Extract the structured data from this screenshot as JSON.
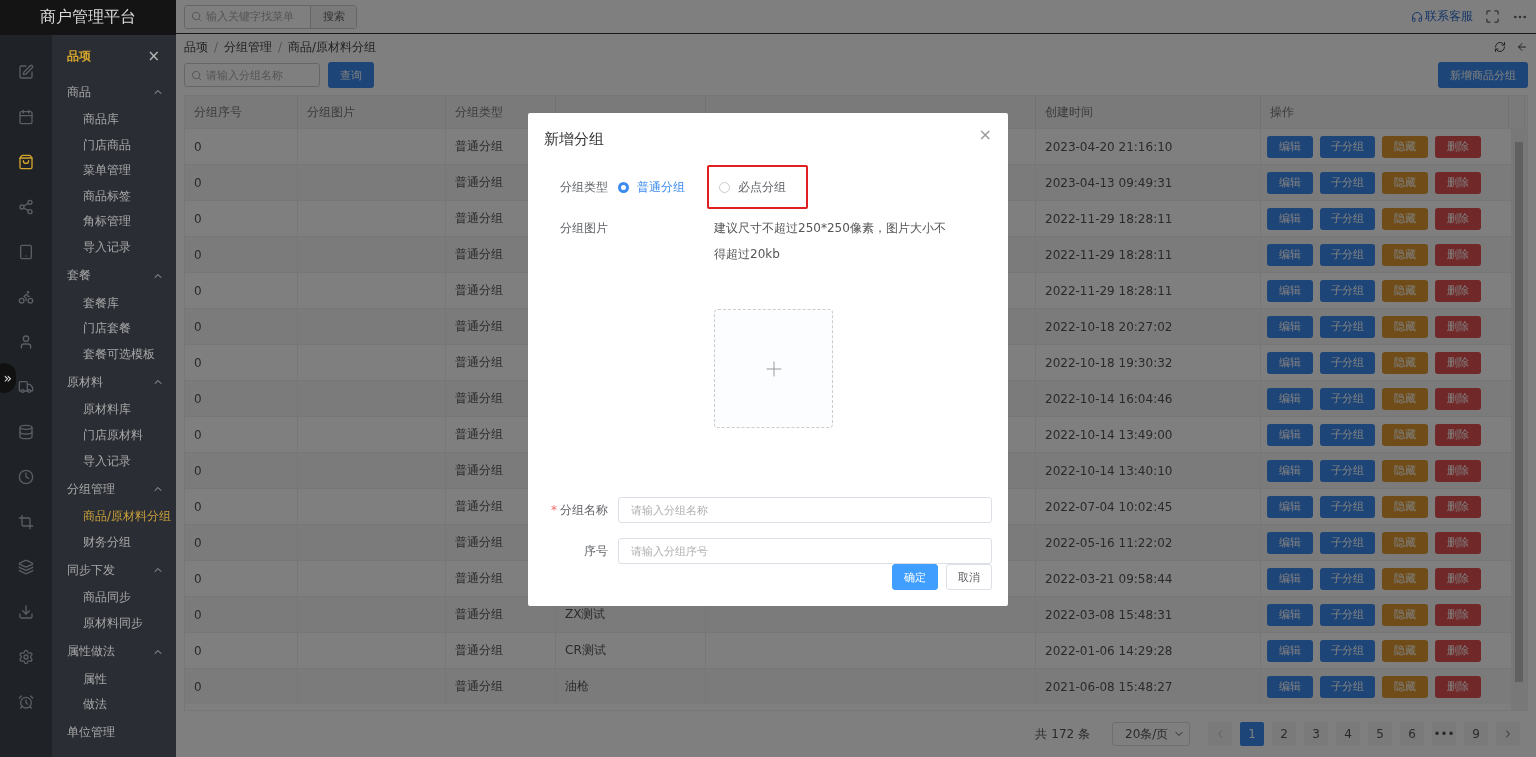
{
  "sidebar": {
    "logo": "商户管理平台",
    "rail": [
      {
        "selected": false
      },
      {
        "selected": false
      },
      {
        "selected": true
      },
      {
        "selected": false
      },
      {
        "selected": false
      },
      {
        "selected": false
      },
      {
        "selected": false
      },
      {
        "selected": false
      },
      {
        "selected": false
      },
      {
        "selected": false
      },
      {
        "selected": false
      },
      {
        "selected": false
      },
      {
        "selected": false
      },
      {
        "selected": false
      },
      {
        "selected": false
      }
    ],
    "collapse_toggle": "»",
    "menu_title": "品项",
    "menu_close": "×",
    "menu": [
      {
        "kind": "group",
        "label": "商品",
        "expanded": true,
        "children": [
          {
            "label": "商品库",
            "selected": false
          },
          {
            "label": "门店商品",
            "selected": false
          },
          {
            "label": "菜单管理",
            "selected": false
          },
          {
            "label": "商品标签",
            "selected": false
          },
          {
            "label": "角标管理",
            "selected": false
          },
          {
            "label": "导入记录",
            "selected": false
          }
        ]
      },
      {
        "kind": "group",
        "label": "套餐",
        "expanded": true,
        "children": [
          {
            "label": "套餐库",
            "selected": false
          },
          {
            "label": "门店套餐",
            "selected": false
          },
          {
            "label": "套餐可选模板",
            "selected": false
          }
        ]
      },
      {
        "kind": "group",
        "label": "原材料",
        "expanded": true,
        "children": [
          {
            "label": "原材料库",
            "selected": false
          },
          {
            "label": "门店原材料",
            "selected": false
          },
          {
            "label": "导入记录",
            "selected": false
          }
        ]
      },
      {
        "kind": "group",
        "label": "分组管理",
        "expanded": true,
        "children": [
          {
            "label": "商品/原材料分组",
            "selected": true
          },
          {
            "label": "财务分组",
            "selected": false
          }
        ]
      },
      {
        "kind": "group",
        "label": "同步下发",
        "expanded": true,
        "children": [
          {
            "label": "商品同步",
            "selected": false
          },
          {
            "label": "原材料同步",
            "selected": false
          }
        ]
      },
      {
        "kind": "group",
        "label": "属性做法",
        "expanded": true,
        "children": [
          {
            "label": "属性",
            "selected": false
          },
          {
            "label": "做法",
            "selected": false
          }
        ]
      },
      {
        "kind": "link",
        "label": "单位管理"
      }
    ]
  },
  "header": {
    "search": {
      "placeholder": "输入关键字找菜单"
    },
    "search_button": "搜索",
    "support_link": "联系客服"
  },
  "breadcrumb": {
    "separator": "/",
    "items": [
      "品项",
      "分组管理",
      "商品/原材料分组"
    ]
  },
  "toolbar": {
    "search": {
      "placeholder": "请输入分组名称"
    },
    "query_button": "查询",
    "add_button": "新增商品分组"
  },
  "table": {
    "columns": [
      "分组序号",
      "分组图片",
      "分组类型",
      "创建时间",
      "操作"
    ],
    "rows": [
      {
        "seq": "0",
        "type": "普通分组",
        "created": "2023-04-20 21:16:10",
        "actions": [
          {
            "kind": "edit",
            "label": "编辑"
          },
          {
            "kind": "sub",
            "label": "子分组"
          },
          {
            "kind": "hide",
            "label": "隐藏"
          },
          {
            "kind": "delete",
            "label": "删除"
          }
        ]
      },
      {
        "seq": "0",
        "type": "普通分组",
        "created": "2023-04-13 09:49:31",
        "actions": [
          {
            "kind": "edit",
            "label": "编辑"
          },
          {
            "kind": "sub",
            "label": "子分组"
          },
          {
            "kind": "hide",
            "label": "隐藏"
          },
          {
            "kind": "delete",
            "label": "删除"
          }
        ]
      },
      {
        "seq": "0",
        "type": "普通分组",
        "created": "2022-11-29 18:28:11",
        "actions": [
          {
            "kind": "edit",
            "label": "编辑"
          },
          {
            "kind": "sub",
            "label": "子分组"
          },
          {
            "kind": "hide",
            "label": "隐藏"
          },
          {
            "kind": "delete",
            "label": "删除"
          }
        ]
      },
      {
        "seq": "0",
        "type": "普通分组",
        "created": "2022-11-29 18:28:11",
        "actions": [
          {
            "kind": "edit",
            "label": "编辑"
          },
          {
            "kind": "sub",
            "label": "子分组"
          },
          {
            "kind": "hide",
            "label": "隐藏"
          },
          {
            "kind": "delete",
            "label": "删除"
          }
        ]
      },
      {
        "seq": "0",
        "type": "普通分组",
        "created": "2022-11-29 18:28:11",
        "actions": [
          {
            "kind": "edit",
            "label": "编辑"
          },
          {
            "kind": "sub",
            "label": "子分组"
          },
          {
            "kind": "hide",
            "label": "隐藏"
          },
          {
            "kind": "delete",
            "label": "删除"
          }
        ]
      },
      {
        "seq": "0",
        "type": "普通分组",
        "created": "2022-10-18 20:27:02",
        "actions": [
          {
            "kind": "edit",
            "label": "编辑"
          },
          {
            "kind": "sub",
            "label": "子分组"
          },
          {
            "kind": "hide",
            "label": "隐藏"
          },
          {
            "kind": "delete",
            "label": "删除"
          }
        ]
      },
      {
        "seq": "0",
        "type": "普通分组",
        "created": "2022-10-18 19:30:32",
        "actions": [
          {
            "kind": "edit",
            "label": "编辑"
          },
          {
            "kind": "sub",
            "label": "子分组"
          },
          {
            "kind": "hide",
            "label": "隐藏"
          },
          {
            "kind": "delete",
            "label": "删除"
          }
        ]
      },
      {
        "seq": "0",
        "type": "普通分组",
        "created": "2022-10-14 16:04:46",
        "actions": [
          {
            "kind": "edit",
            "label": "编辑"
          },
          {
            "kind": "sub",
            "label": "子分组"
          },
          {
            "kind": "hide",
            "label": "隐藏"
          },
          {
            "kind": "delete",
            "label": "删除"
          }
        ]
      },
      {
        "seq": "0",
        "type": "普通分组",
        "created": "2022-10-14 13:49:00",
        "actions": [
          {
            "kind": "edit",
            "label": "编辑"
          },
          {
            "kind": "sub",
            "label": "子分组"
          },
          {
            "kind": "hide",
            "label": "隐藏"
          },
          {
            "kind": "delete",
            "label": "删除"
          }
        ]
      },
      {
        "seq": "0",
        "type": "普通分组",
        "created": "2022-10-14 13:40:10",
        "actions": [
          {
            "kind": "edit",
            "label": "编辑"
          },
          {
            "kind": "sub",
            "label": "子分组"
          },
          {
            "kind": "hide",
            "label": "隐藏"
          },
          {
            "kind": "delete",
            "label": "删除"
          }
        ]
      },
      {
        "seq": "0",
        "type": "普通分组",
        "created": "2022-07-04 10:02:45",
        "actions": [
          {
            "kind": "edit",
            "label": "编辑"
          },
          {
            "kind": "sub",
            "label": "子分组"
          },
          {
            "kind": "hide",
            "label": "隐藏"
          },
          {
            "kind": "delete",
            "label": "删除"
          }
        ]
      },
      {
        "seq": "0",
        "type": "普通分组",
        "created": "2022-05-16 11:22:02",
        "actions": [
          {
            "kind": "edit",
            "label": "编辑"
          },
          {
            "kind": "sub",
            "label": "子分组"
          },
          {
            "kind": "hide",
            "label": "隐藏"
          },
          {
            "kind": "delete",
            "label": "删除"
          }
        ]
      },
      {
        "seq": "0",
        "type": "普通分组",
        "created": "2022-03-21 09:58:44",
        "actions": [
          {
            "kind": "edit",
            "label": "编辑"
          },
          {
            "kind": "sub",
            "label": "子分组"
          },
          {
            "kind": "hide",
            "label": "隐藏"
          },
          {
            "kind": "delete",
            "label": "删除"
          }
        ]
      },
      {
        "seq": "0",
        "type": "普通分组",
        "name": "ZX测试",
        "created": "2022-03-08 15:48:31",
        "actions": [
          {
            "kind": "edit",
            "label": "编辑"
          },
          {
            "kind": "sub",
            "label": "子分组"
          },
          {
            "kind": "hide",
            "label": "隐藏"
          },
          {
            "kind": "delete",
            "label": "删除"
          }
        ]
      },
      {
        "seq": "0",
        "type": "普通分组",
        "name": "CR测试",
        "created": "2022-01-06 14:29:28",
        "actions": [
          {
            "kind": "edit",
            "label": "编辑"
          },
          {
            "kind": "sub",
            "label": "子分组"
          },
          {
            "kind": "hide",
            "label": "隐藏"
          },
          {
            "kind": "delete",
            "label": "删除"
          }
        ]
      },
      {
        "seq": "0",
        "type": "普通分组",
        "name": "油枪",
        "created": "2021-06-08 15:48:27",
        "actions": [
          {
            "kind": "edit",
            "label": "编辑"
          },
          {
            "kind": "sub",
            "label": "子分组"
          },
          {
            "kind": "hide",
            "label": "隐藏"
          },
          {
            "kind": "delete",
            "label": "删除"
          }
        ]
      }
    ]
  },
  "pagination": {
    "total": "共 172 条",
    "page_size": "20条/页",
    "pages": [
      {
        "label": "1",
        "selected": true
      },
      {
        "label": "2",
        "selected": false
      },
      {
        "label": "3",
        "selected": false
      },
      {
        "label": "4",
        "selected": false
      },
      {
        "label": "5",
        "selected": false
      },
      {
        "label": "6",
        "selected": false
      },
      {
        "label": "•••",
        "selected": false
      },
      {
        "label": "9",
        "selected": false
      }
    ]
  },
  "dialog": {
    "title": "新增分组",
    "close": "×",
    "type_field": {
      "label": "分组类型",
      "options": [
        {
          "label": "普通分组",
          "selected": true,
          "highlighted": false
        },
        {
          "label": "必点分组",
          "selected": false,
          "highlighted": true
        }
      ]
    },
    "image_field": {
      "label": "分组图片",
      "hint": "建议尺寸不超过250*250像素，图片大小不得超过20kb"
    },
    "name_field": {
      "label": "分组名称",
      "required_mark": "*",
      "placeholder": "请输入分组名称"
    },
    "seq_field": {
      "label": "序号",
      "placeholder": "请输入分组序号"
    },
    "buttons": [
      {
        "kind": "primary",
        "label": "确定"
      },
      {
        "kind": "default",
        "label": "取消"
      }
    ]
  }
}
